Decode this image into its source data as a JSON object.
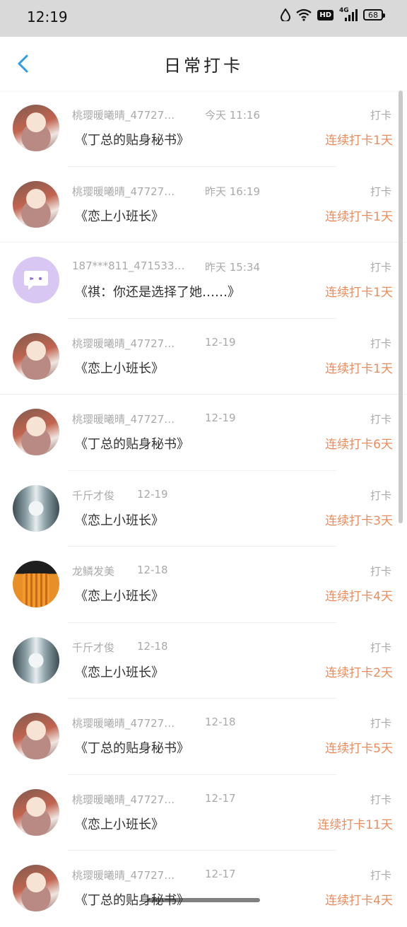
{
  "status_bar": {
    "time": "12:19",
    "network": "4G",
    "hd": "HD",
    "battery": "68"
  },
  "header": {
    "title": "日常打卡"
  },
  "checkins": [
    {
      "username": "桃璎暖曦晴_47727…",
      "time": "今天 11:16",
      "book": "《丁总的贴身秘书》",
      "label": "打卡",
      "streak": "连续打卡1天",
      "avatar": "anime"
    },
    {
      "username": "桃璎暖曦晴_47727…",
      "time": "昨天 16:19",
      "book": "《恋上小班长》",
      "label": "打卡",
      "streak": "连续打卡1天",
      "avatar": "anime"
    },
    {
      "username": "187***811_471533…",
      "time": "昨天 15:34",
      "book": "《祺：你还是选择了她……》",
      "label": "打卡",
      "streak": "连续打卡1天",
      "avatar": "bot"
    },
    {
      "username": "桃璎暖曦晴_47727…",
      "time": "12-19",
      "book": "《恋上小班长》",
      "label": "打卡",
      "streak": "连续打卡1天",
      "avatar": "anime"
    },
    {
      "username": "桃璎暖曦晴_47727…",
      "time": "12-19",
      "book": "《丁总的贴身秘书》",
      "label": "打卡",
      "streak": "连续打卡6天",
      "avatar": "anime"
    },
    {
      "username": "千斤才俊",
      "time": "12-19",
      "book": "《恋上小班长》",
      "label": "打卡",
      "streak": "连续打卡3天",
      "avatar": "forest"
    },
    {
      "username": "龙鳞发美",
      "time": "12-18",
      "book": "《恋上小班长》",
      "label": "打卡",
      "streak": "连续打卡4天",
      "avatar": "photo"
    },
    {
      "username": "千斤才俊",
      "time": "12-18",
      "book": "《恋上小班长》",
      "label": "打卡",
      "streak": "连续打卡2天",
      "avatar": "forest"
    },
    {
      "username": "桃璎暖曦晴_47727…",
      "time": "12-18",
      "book": "《丁总的贴身秘书》",
      "label": "打卡",
      "streak": "连续打卡5天",
      "avatar": "anime"
    },
    {
      "username": "桃璎暖曦晴_47727…",
      "time": "12-17",
      "book": "《恋上小班长》",
      "label": "打卡",
      "streak": "连续打卡11天",
      "avatar": "anime"
    },
    {
      "username": "桃璎暖曦晴_47727…",
      "time": "12-17",
      "book": "《丁总的贴身秘书》",
      "label": "打卡",
      "streak": "连续打卡4天",
      "avatar": "anime"
    }
  ],
  "colors": {
    "accent": "#e98d5e",
    "back_arrow": "#2f9be6",
    "muted_text": "#aaaaaa"
  }
}
